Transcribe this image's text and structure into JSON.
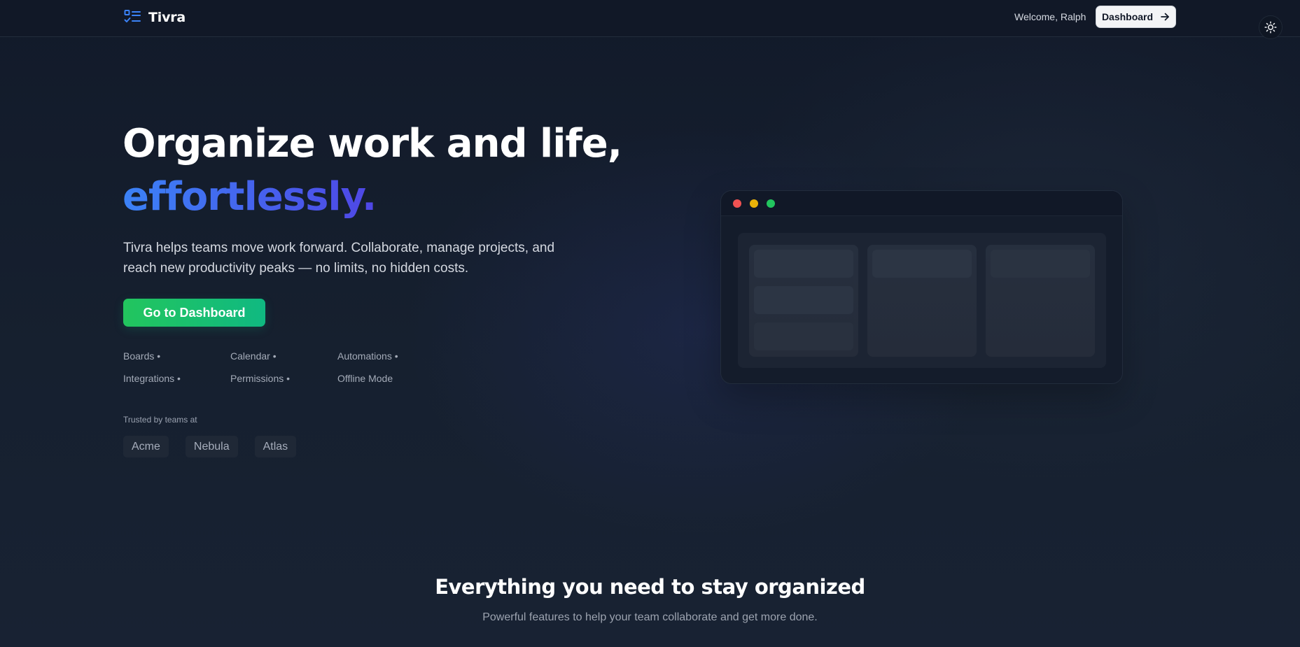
{
  "colors": {
    "background": "#131b2b",
    "header_bg": "#111827",
    "accent_blue": "#3b82f6",
    "accent_indigo": "#4f46e5",
    "cta_green": "#22c55e"
  },
  "header": {
    "brand_icon": "checklist-icon",
    "brand_name": "Tivra",
    "welcome": "Welcome, Ralph",
    "dashboard_label": "Dashboard",
    "dashboard_icon": "arrow-right-icon",
    "theme_icon": "sun-icon"
  },
  "hero": {
    "title_line1": "Organize work and life,",
    "title_line2": "effortlessly.",
    "subtitle_line1": "Tivra helps teams move work forward. Collaborate, manage projects, and",
    "subtitle_line2": "reach new productivity peaks — no limits, no hidden costs.",
    "cta_label": "Go to Dashboard",
    "features": [
      "Boards •",
      "Calendar •",
      "Automations •",
      "Integrations •",
      "Permissions •",
      "Offline Mode"
    ],
    "trusted_label": "Trusted by teams at",
    "logos": [
      "Acme",
      "Nebula",
      "Atlas"
    ]
  },
  "section": {
    "title": "Everything you need to stay organized",
    "subtitle": "Powerful features to help your team collaborate and get more done."
  }
}
